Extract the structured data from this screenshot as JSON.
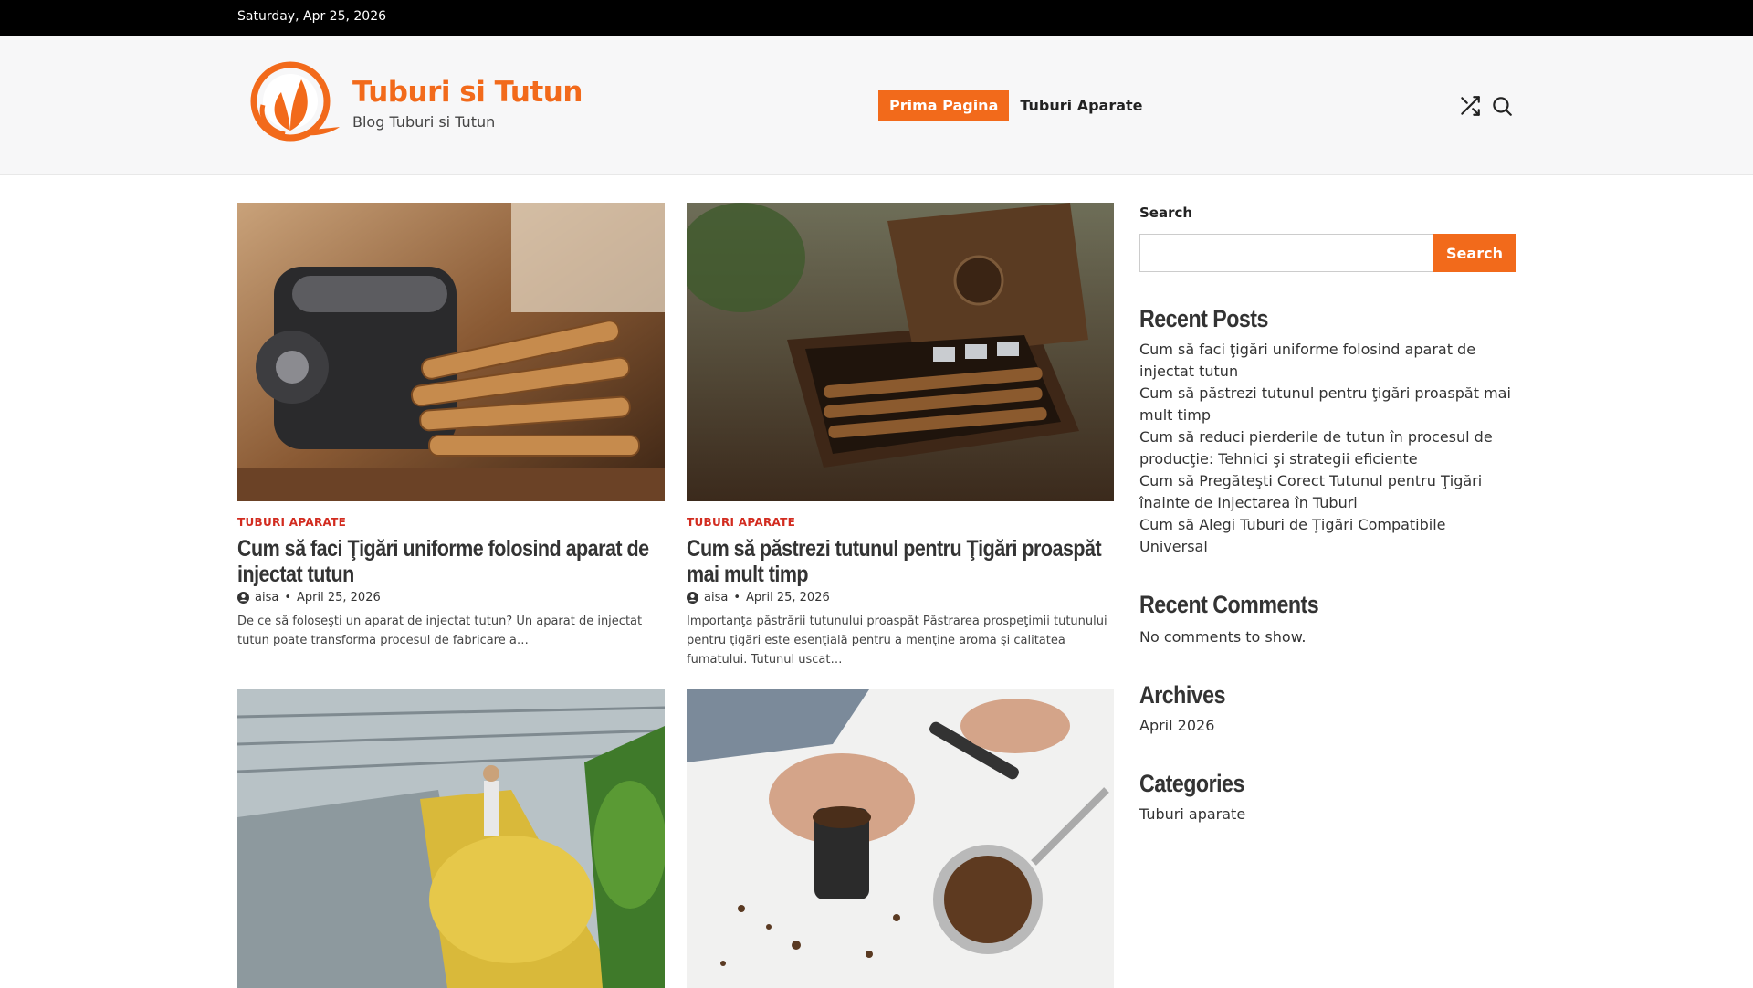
{
  "topbar": {
    "date": "Saturday, Apr 25, 2026"
  },
  "header": {
    "site_title": "Tuburi si Tutun",
    "tagline": "Blog Tuburi si Tutun",
    "logo_icon": "leaf-logo-icon",
    "nav": [
      {
        "label": "Prima Pagina",
        "active": true
      },
      {
        "label": "Tuburi Aparate",
        "active": false
      }
    ],
    "icons": [
      "shuffle-icon",
      "search-icon"
    ]
  },
  "accent": "#f26a1b",
  "category_color": "#d22b1f",
  "posts": [
    {
      "category": "TUBURI APARATE",
      "title": "Cum să faci Ţigări uniforme folosind aparat de injectat tutun",
      "author": "aisa",
      "date": "April 25, 2026",
      "excerpt": "De ce să foloseşti un aparat de injectat tutun? Un aparat de injectat tutun poate transforma procesul de fabricare a…"
    },
    {
      "category": "TUBURI APARATE",
      "title": "Cum să păstrezi tutunul pentru Ţigări proaspăt mai mult timp",
      "author": "aisa",
      "date": "April 25, 2026",
      "excerpt": "Importanţa păstrării tutunului proaspăt Păstrarea prospeţimii tutunului pentru ţigări este esenţială pentru a menţine aroma şi calitatea fumatului. Tutunul uscat…"
    }
  ],
  "sidebar": {
    "search_label": "Search",
    "search_placeholder": "",
    "search_button": "Search",
    "recent_posts_title": "Recent Posts",
    "recent_posts": [
      "Cum să faci ţigări uniforme folosind aparat de injectat tutun",
      "Cum să păstrezi tutunul pentru ţigări proaspăt mai mult timp",
      "Cum să reduci pierderile de tutun în procesul de producţie: Tehnici şi strategii eficiente",
      "Cum să Pregăteşti Corect Tutunul pentru Ţigări înainte de Injectarea în Tuburi",
      "Cum să Alegi Tuburi de Ţigări Compatibile Universal"
    ],
    "recent_comments_title": "Recent Comments",
    "recent_comments_text": "No comments to show.",
    "archives_title": "Archives",
    "archives": [
      "April 2026"
    ],
    "categories_title": "Categories",
    "categories": [
      "Tuburi aparate"
    ]
  }
}
